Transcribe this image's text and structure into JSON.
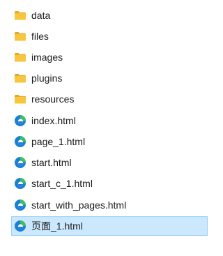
{
  "file_list": {
    "items": [
      {
        "name": "data",
        "type": "folder",
        "icon": "folder-icon"
      },
      {
        "name": "files",
        "type": "folder",
        "icon": "folder-icon"
      },
      {
        "name": "images",
        "type": "folder",
        "icon": "folder-icon"
      },
      {
        "name": "plugins",
        "type": "folder",
        "icon": "folder-icon"
      },
      {
        "name": "resources",
        "type": "folder",
        "icon": "folder-icon"
      },
      {
        "name": "index.html",
        "type": "html",
        "icon": "edge-html-icon"
      },
      {
        "name": "page_1.html",
        "type": "html",
        "icon": "edge-html-icon"
      },
      {
        "name": "start.html",
        "type": "html",
        "icon": "edge-html-icon"
      },
      {
        "name": "start_c_1.html",
        "type": "html",
        "icon": "edge-html-icon"
      },
      {
        "name": "start_with_pages.html",
        "type": "html",
        "icon": "edge-html-icon"
      },
      {
        "name": "页面_1.html",
        "type": "html",
        "icon": "edge-html-icon",
        "selected": true
      }
    ]
  },
  "colors": {
    "folder": "#f8c63d",
    "folder_dark": "#e8a628",
    "edge_blue": "#1b7fd6",
    "edge_green": "#3fbf5f",
    "selection": "#cce8ff",
    "selection_border": "#99d1ff"
  }
}
